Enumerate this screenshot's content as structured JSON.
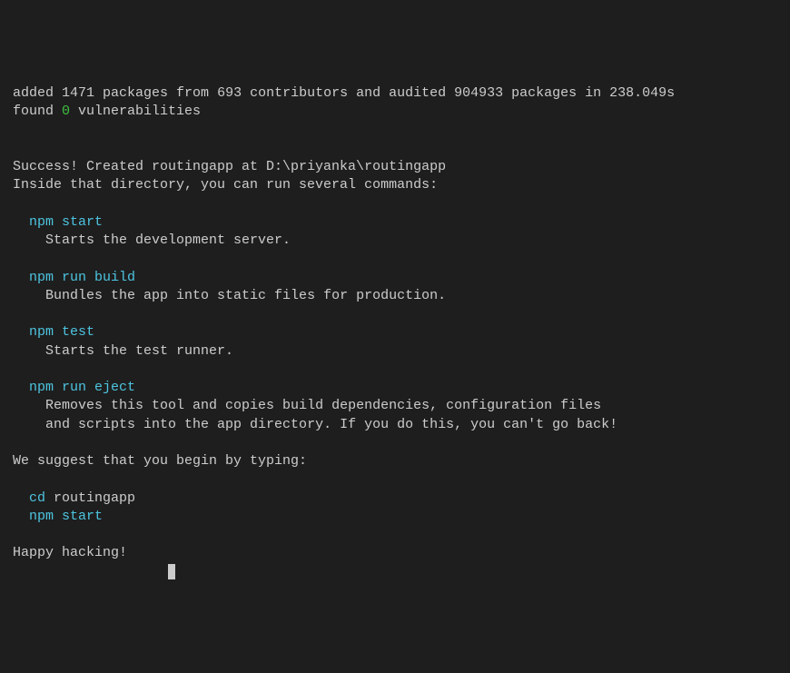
{
  "summary": {
    "prefix": "added ",
    "packages": "1471",
    "mid1": " packages from ",
    "contributors": "693",
    "mid2": " contributors and audited ",
    "audited": "904933",
    "mid3": " packages in ",
    "time": "238.049s"
  },
  "vuln": {
    "prefix": "found ",
    "count": "0",
    "suffix": " vulnerabilities"
  },
  "success": {
    "line1": "Success! Created routingapp at D:\\priyanka\\routingapp",
    "line2": "Inside that directory, you can run several commands:"
  },
  "cmd1": {
    "name": "npm start",
    "desc": "Starts the development server."
  },
  "cmd2": {
    "name": "npm run build",
    "desc": "Bundles the app into static files for production."
  },
  "cmd3": {
    "name": "npm test",
    "desc": "Starts the test runner."
  },
  "cmd4": {
    "name": "npm run eject",
    "desc1": "Removes this tool and copies build dependencies, configuration files",
    "desc2": "and scripts into the app directory. If you do this, you can't go back!"
  },
  "suggest": {
    "intro": "We suggest that you begin by typing:",
    "cd_cmd": "cd ",
    "cd_arg": "routingapp",
    "start_cmd": "npm start"
  },
  "footer": "Happy hacking!"
}
